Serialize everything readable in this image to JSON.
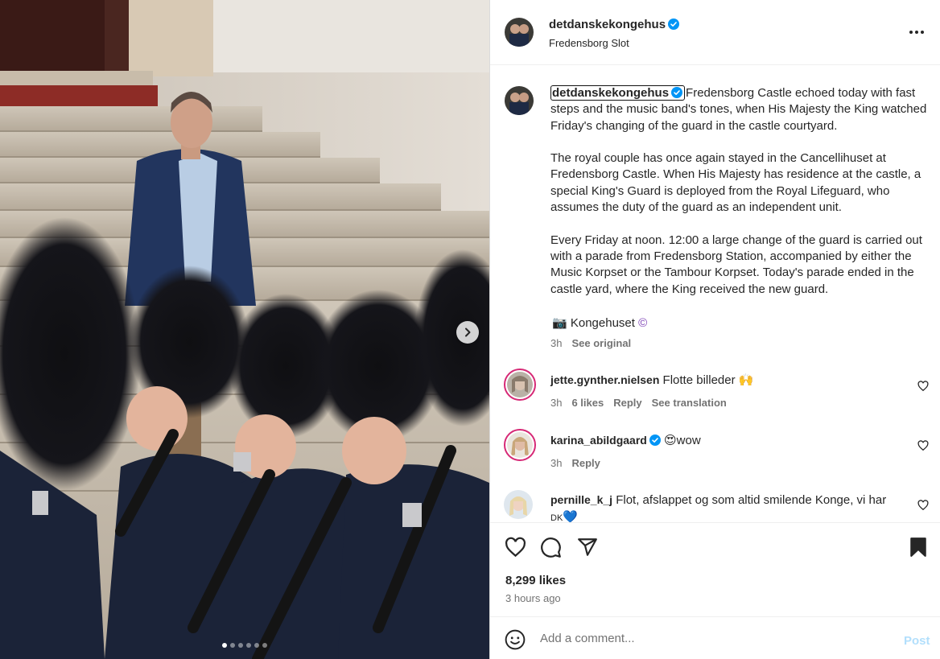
{
  "post": {
    "author": "detdanskekongehus",
    "location": "Fredensborg Slot",
    "caption": [
      "Fredensborg Castle echoed today with fast steps and the music band's tones, when His Majesty the King watched Friday's changing of the guard in the castle courtyard.",
      "The royal couple has once again stayed in the Cancellihuset at Fredensborg Castle. When His Majesty has residence at the castle, a special King's Guard is deployed from the Royal Lifeguard, who assumes the duty of the guard as an independent unit.",
      "Every Friday at noon. 12:00 a large change of the guard is carried out with a parade from Fredensborg Station, accompanied by either the Music Korpset or the Tambour Korpset. Today's parade ended in the castle yard, where the King received the new guard."
    ],
    "credit_emoji": "📷",
    "credit_text": "Kongehuset",
    "credit_symbol": "©",
    "time": "3h",
    "see_original": "See original",
    "likes": "8,299 likes",
    "time_ago": "3 hours ago"
  },
  "comments": [
    {
      "user": "jette.gynther.nielsen",
      "text": "Flotte billeder",
      "emoji": "🙌",
      "time": "3h",
      "likes": "6 likes",
      "reply": "Reply",
      "translate": "See translation"
    },
    {
      "user": "karina_abildgaard",
      "emoji": "😍",
      "text": "wow",
      "time": "3h",
      "reply": "Reply"
    },
    {
      "user": "pernille_k_j",
      "text": "Flot, afslappet og som altid smilende Konge, vi har",
      "text_line2": "DK",
      "emoji": "💙"
    }
  ],
  "composer": {
    "placeholder": "Add a comment...",
    "post_label": "Post"
  },
  "carousel": {
    "slide_count": 6,
    "active_index": 0
  },
  "colors": {
    "verified_blue": "#0095f6",
    "post_button_disabled": "#b2dffc",
    "story_ring": "#d62976"
  },
  "icons": [
    "more-icon",
    "verified-badge-icon",
    "heart-icon",
    "comment-icon",
    "share-icon",
    "bookmark-icon",
    "emoji-icon",
    "chevron-right-icon"
  ]
}
